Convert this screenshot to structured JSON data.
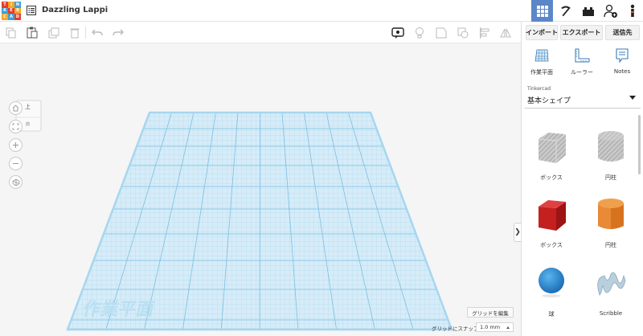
{
  "app": {
    "logo_letters": [
      "TIN",
      "KER",
      "CAD"
    ],
    "document_title": "Dazzling Lappi"
  },
  "header": {
    "buttons": [
      {
        "icon": "grid-view-icon",
        "active": true
      },
      {
        "icon": "pickaxe-icon",
        "active": false
      },
      {
        "icon": "bricks-icon",
        "active": false
      },
      {
        "icon": "add-user-icon",
        "active": false
      },
      {
        "icon": "user-profile-icon",
        "active": false
      }
    ]
  },
  "toolbar": {
    "icons": [
      "copy-icon",
      "paste-icon",
      "duplicate-icon",
      "delete-icon",
      "undo-icon",
      "redo-icon",
      "notes-toggle-icon",
      "light-icon",
      "shape-solid-icon",
      "shape-hole-icon",
      "align-icon",
      "mirror-icon"
    ]
  },
  "panel": {
    "import_label": "インポート",
    "export_label": "エクスポート",
    "send_label": "送信先",
    "tools": [
      {
        "label": "作業平面",
        "icon": "workplane-icon"
      },
      {
        "label": "ルーラー",
        "icon": "ruler-icon"
      },
      {
        "label": "Notes",
        "icon": "notes-icon"
      }
    ],
    "library_category": "Tinkercad",
    "library_name": "基本シェイプ",
    "shapes": [
      {
        "label": "ボックス",
        "icon": "box-hole-icon"
      },
      {
        "label": "円柱",
        "icon": "cylinder-hole-icon"
      },
      {
        "label": "ボックス",
        "icon": "box-icon"
      },
      {
        "label": "円柱",
        "icon": "cylinder-icon"
      },
      {
        "label": "球",
        "icon": "sphere-icon"
      },
      {
        "label": "Scribble",
        "icon": "scribble-icon"
      }
    ]
  },
  "viewport": {
    "viewcube_top": "上",
    "viewcube_front": "前",
    "workplane_label": "作業平面",
    "edit_grid_label": "グリッドを編集",
    "snap_label": "グリッドにスナップ",
    "snap_value": "1.0 mm"
  },
  "colors": {
    "accent": "#5b87c8",
    "grid_fill": "#cfe7f5",
    "grid_line": "#8ec8e8",
    "box_red": "#d42a2a",
    "cylinder_orange": "#e8842a",
    "sphere_blue": "#2a8ad6"
  }
}
